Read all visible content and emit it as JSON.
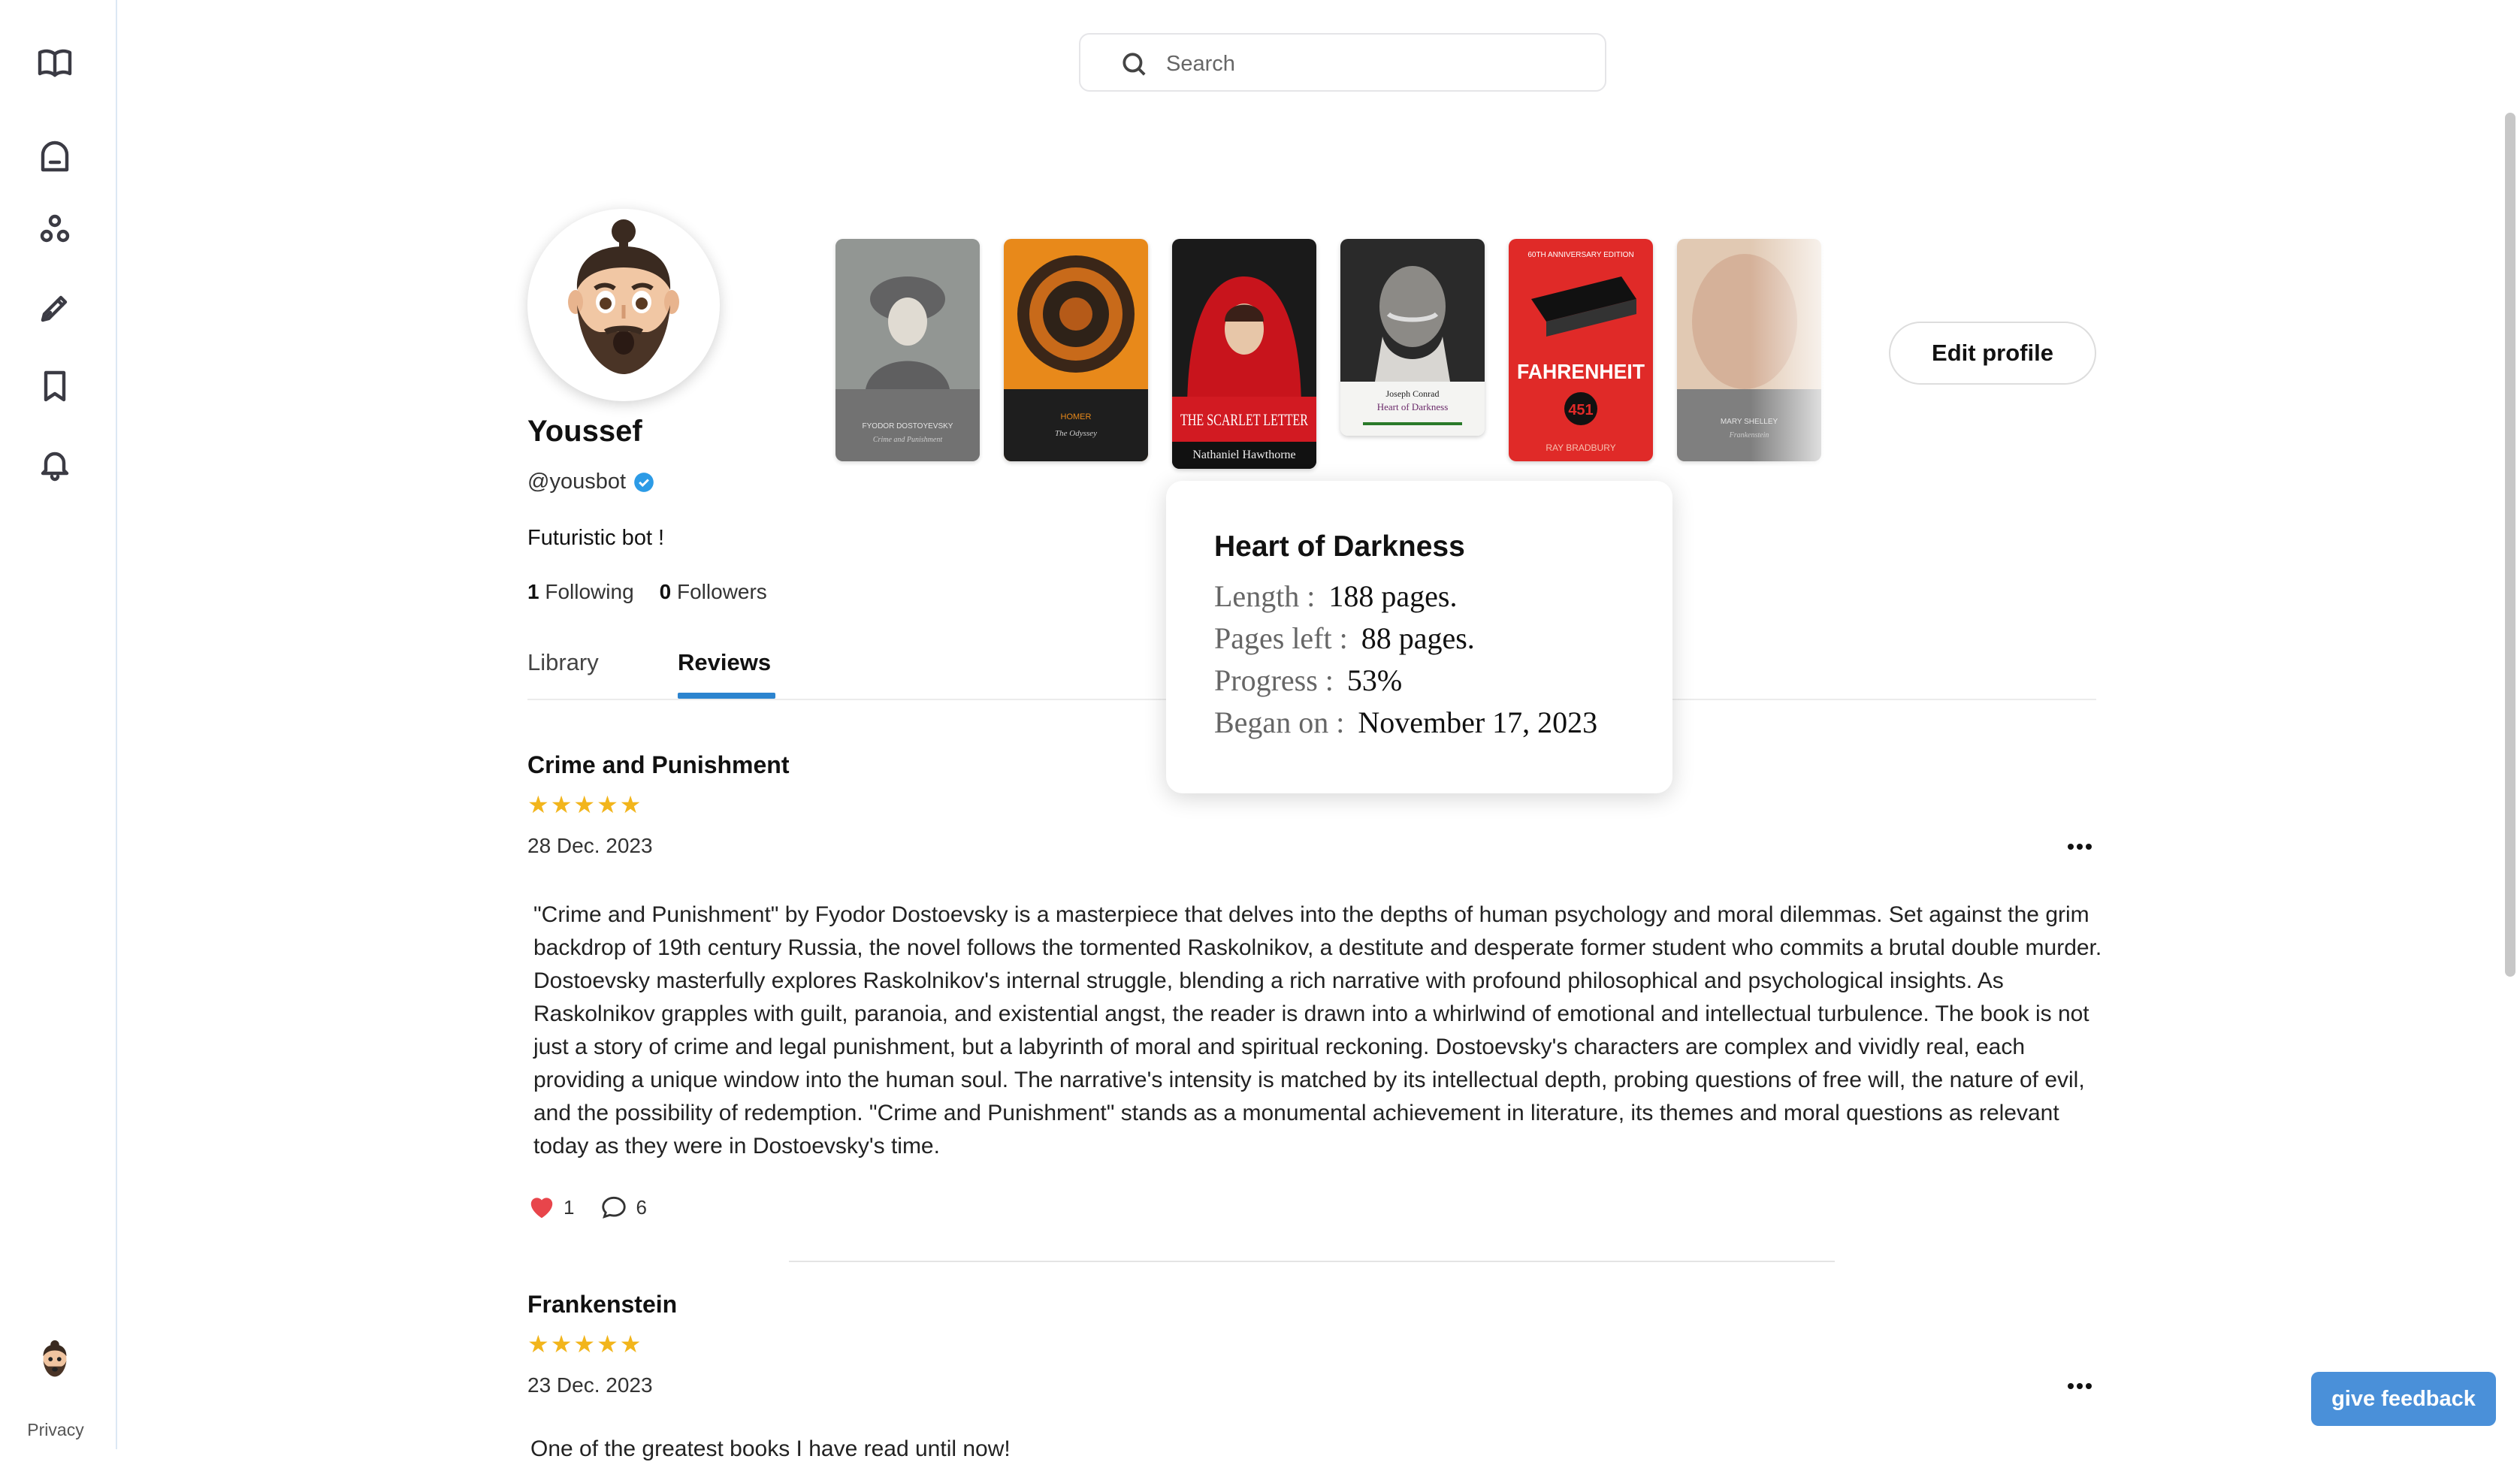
{
  "sidebar": {
    "icons": [
      "book-open-icon",
      "home-icon",
      "community-icon",
      "pen-icon",
      "bookmark-icon",
      "bell-icon"
    ],
    "privacy_label": "Privacy"
  },
  "search": {
    "placeholder": "Search"
  },
  "profile": {
    "name": "Youssef",
    "handle": "@yousbot",
    "bio": "Futuristic bot !",
    "following_count": "1",
    "following_label": "Following",
    "followers_count": "0",
    "followers_label": "Followers",
    "edit_label": "Edit profile"
  },
  "tabs": [
    {
      "label": "Library",
      "active": false
    },
    {
      "label": "Reviews",
      "active": true
    }
  ],
  "books": [
    {
      "name": "book-cover-crime-and-punishment",
      "top_text": "",
      "title_text": "FYODOR DOSTOYEVSKY",
      "sub_text": "Crime and Punishment"
    },
    {
      "name": "book-cover-the-odyssey",
      "top_text": "",
      "title_text": "HOMER",
      "sub_text": "The Odyssey"
    },
    {
      "name": "book-cover-the-scarlet-letter",
      "top_text": "",
      "title_text": "THE SCARLET LETTER",
      "sub_text": "Nathaniel Hawthorne"
    },
    {
      "name": "book-cover-heart-of-darkness",
      "top_text": "Joseph Conrad",
      "title_text": "Heart of Darkness",
      "sub_text": ""
    },
    {
      "name": "book-cover-fahrenheit-451",
      "top_text": "60TH ANNIVERSARY EDITION",
      "title_text": "FAHRENHEIT",
      "sub_text": "RAY BRADBURY",
      "badge": "451"
    },
    {
      "name": "book-cover-frankenstein",
      "top_text": "",
      "title_text": "MARY SHELLEY",
      "sub_text": "Frankenstein"
    }
  ],
  "popup": {
    "title": "Heart of Darkness",
    "length_label": "Length :",
    "length_value": "188 pages.",
    "pages_left_label": "Pages left :",
    "pages_left_value": "88 pages.",
    "progress_label": "Progress :",
    "progress_value": "53%",
    "began_label": "Began on :",
    "began_value": "November 17, 2023"
  },
  "reviews": [
    {
      "title": "Crime and Punishment",
      "stars": "★★★★★",
      "date": "28 Dec. 2023",
      "body": "\"Crime and Punishment\" by Fyodor Dostoevsky is a masterpiece that delves into the depths of human psychology and moral dilemmas. Set against the grim backdrop of 19th century Russia, the novel follows the tormented Raskolnikov, a destitute and desperate former student who commits a brutal double murder. Dostoevsky masterfully explores Raskolnikov's internal struggle, blending a rich narrative with profound philosophical and psychological insights. As Raskolnikov grapples with guilt, paranoia, and existential angst, the reader is drawn into a whirlwind of emotional and intellectual turbulence. The book is not just a story of crime and legal punishment, but a labyrinth of moral and spiritual reckoning. Dostoevsky's characters are complex and vividly real, each providing a unique window into the human soul. The narrative's intensity is matched by its intellectual depth, probing questions of free will, the nature of evil, and the possibility of redemption. \"Crime and Punishment\" stands as a monumental achievement in literature, its themes and moral questions as relevant today as they were in Dostoevsky's time.",
      "likes": "1",
      "comments": "6"
    },
    {
      "title": "Frankenstein",
      "stars": "★★★★★",
      "date": "23 Dec. 2023",
      "body_partial": "One of the greatest books I have read until now!"
    }
  ],
  "feedback_label": "give feedback",
  "colors": {
    "accent": "#2c84cf",
    "star": "#f2b51c",
    "heart": "#e8454b",
    "feedback": "#4a90d9"
  }
}
